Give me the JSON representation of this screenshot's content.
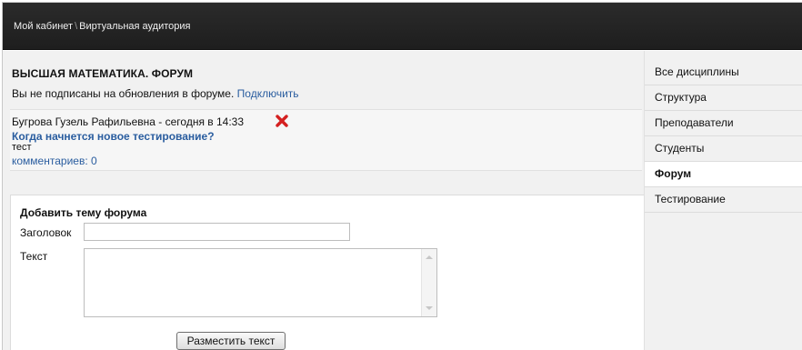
{
  "breadcrumb": {
    "home": "Мой кабинет",
    "separator": "\\",
    "current": "Виртуальная аудитория"
  },
  "forum": {
    "title": "ВЫСШАЯ МАТЕМАТИКА. ФОРУМ",
    "subscribe_text": "Вы не подписаны на обновления в форуме.",
    "subscribe_link": "Подключить"
  },
  "post": {
    "author_line": "Бугрова Гузель Рафильевна - сегодня в 14:33",
    "delete_icon": "close-icon",
    "title": "Когда начнется новое тестирование?",
    "body": "тест",
    "comments": "комментариев: 0"
  },
  "add_topic": {
    "heading": "Добавить тему форума",
    "title_label": "Заголовок",
    "title_value": "",
    "text_label": "Текст",
    "text_value": "",
    "submit_label": "Разместить текст"
  },
  "sidebar": {
    "items": [
      {
        "label": "Все дисциплины"
      },
      {
        "label": "Структура"
      },
      {
        "label": "Преподаватели"
      },
      {
        "label": "Студенты"
      },
      {
        "label": "Форум"
      },
      {
        "label": "Тестирование"
      }
    ],
    "active": "Форум"
  },
  "colors": {
    "topbar": "#222222",
    "link": "#2a5d9f",
    "delete_icon": "#d42020",
    "panel_bg": "#f1f1f1"
  }
}
